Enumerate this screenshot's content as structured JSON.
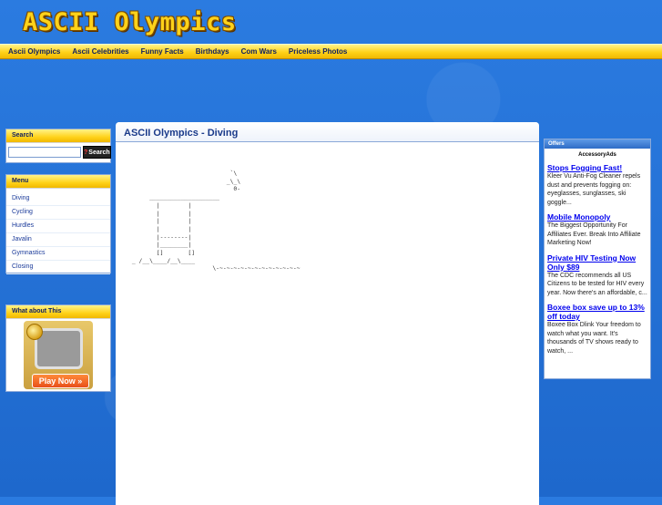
{
  "site": {
    "title": "ASCII Olympics"
  },
  "nav": [
    "Ascii Olympics",
    "Ascii Celebrities",
    "Funny Facts",
    "Birthdays",
    "Com Wars",
    "Priceless Photos"
  ],
  "search": {
    "title": "Search",
    "button": "Search",
    "button_icon": "question-mark-icon",
    "value": ""
  },
  "menu": {
    "title": "Menu",
    "items": [
      "Diving",
      "Cycling",
      "Hurdles",
      "Javalin",
      "Gymnastics",
      "Closing"
    ]
  },
  "what_about": {
    "title": "What about This",
    "play_label": "Play Now »"
  },
  "page": {
    "title": "ASCII Olympics - Diving",
    "ascii_art": "                             `\\\n                            _\\_\\\n                              0-\n      ____________________\n        |        |\n        |        |\n        |        |\n        |        |\n        |--------|\n        |________|\n        []       []\n _ /__\\____/__\\____\n                        \\-~-~-~-~-~-~-~-~-~-~-~-~"
  },
  "offers": {
    "title": "Offers",
    "provider": "AccessoryAds",
    "ads": [
      {
        "title": "Stops Fogging Fast!",
        "text": "Kleer Vu Anti-Fog Cleaner repels dust and prevents fogging on: eyeglasses, sunglasses, ski goggle..."
      },
      {
        "title": "Mobile Monopoly",
        "text": "The Biggest Opportunity For Affiliates Ever. Break Into Affiliate Marketing Now!"
      },
      {
        "title": "Private HIV Testing Now Only $89",
        "text": "The CDC recommends all US Citizens to be tested for HIV every year. Now there's an affordable, c..."
      },
      {
        "title": "Boxee box save up to 13% off today",
        "text": "Boxee Box Dlink Your freedom to watch what you want. It's thousands of TV shows ready to watch, ..."
      }
    ]
  },
  "colors": {
    "accent_yellow": "#ffd21a",
    "background_blue": "#1f6dd0",
    "link_blue": "#0000ee"
  }
}
